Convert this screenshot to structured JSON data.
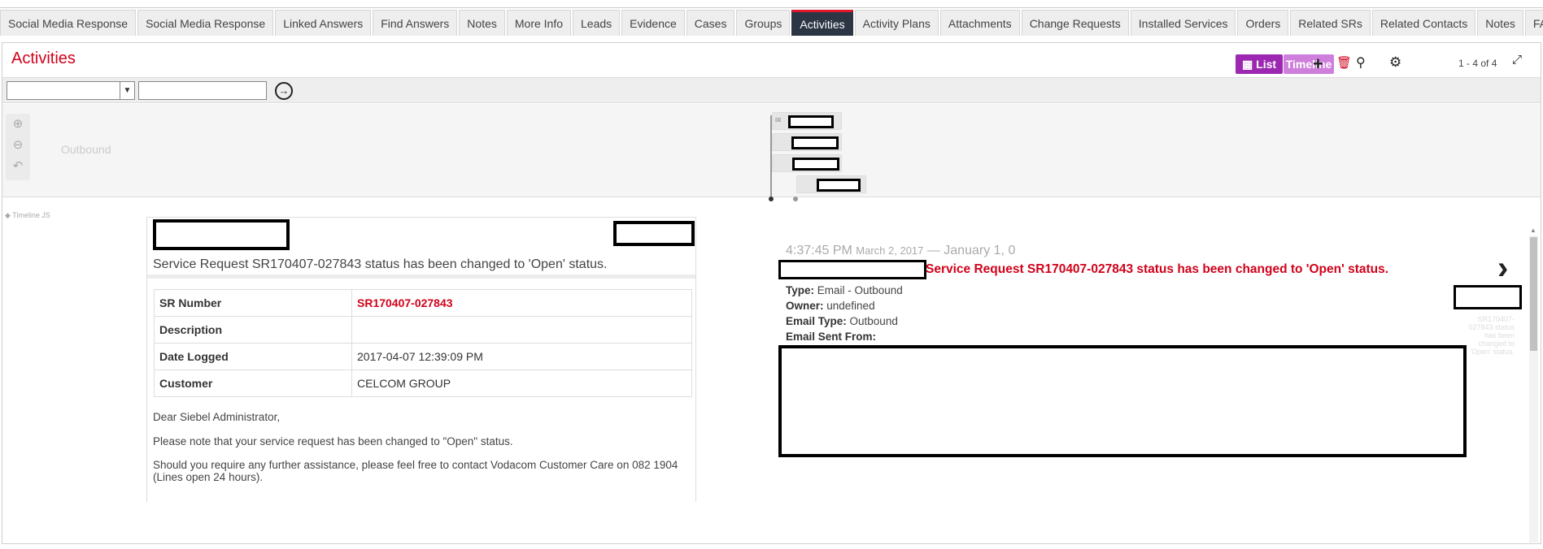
{
  "tabs": [
    "Social Media Response",
    "Social Media Response",
    "Linked Answers",
    "Find Answers",
    "Notes",
    "More Info",
    "Leads",
    "Evidence",
    "Cases",
    "Groups",
    "Activities",
    "Activity Plans",
    "Attachments",
    "Change Requests",
    "Installed Services",
    "Orders",
    "Related SRs",
    "Related Contacts",
    "Notes",
    "FAQs"
  ],
  "active_tab": "Activities",
  "applet": {
    "title": "Activities",
    "list_label": "List",
    "timeline_label": "Timeline",
    "record_count": "1 - 4 of 4"
  },
  "timeline": {
    "group_label": "Outbound",
    "credit": "◆ Timeline JS"
  },
  "card": {
    "subject": "Service Request SR170407-027843 status has been changed to 'Open' status.",
    "rows": [
      {
        "label": "SR Number",
        "value": "SR170407-027843"
      },
      {
        "label": "Description",
        "value": ""
      },
      {
        "label": "Date Logged",
        "value": "2017-04-07 12:39:09 PM"
      },
      {
        "label": "Customer",
        "value": "CELCOM GROUP"
      }
    ],
    "greeting": "Dear Siebel Administrator,",
    "body1": "Please note that your service request has been changed to \"Open\" status.",
    "body2": "Should you require any further assistance, please feel free to contact Vodacom Customer Care on 082 1904 (Lines open 24 hours)."
  },
  "detail": {
    "time": "4:37:45 PM",
    "date": "March 2, 2017",
    "range_end": " — January 1, 0",
    "title": "Service Request SR170407-027843 status has been changed to 'Open' status.",
    "type_label": "Type:",
    "type_value": " Email - Outbound",
    "owner_label": "Owner:",
    "owner_value": " undefined",
    "email_type_label": "Email Type:",
    "email_type_value": " Outbound",
    "email_sent_from_label": "Email Sent From:",
    "faint_caption": "SR170407-027843 status has been changed to 'Open' status."
  }
}
